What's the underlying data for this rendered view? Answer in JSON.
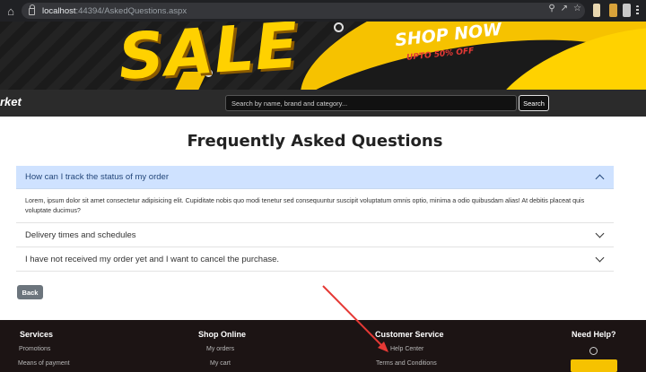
{
  "browser": {
    "url_host": "localhost",
    "url_rest": ":44394/AskedQuestions.aspx"
  },
  "banner": {
    "sale_text": "SALE",
    "shop_now_text": "SHOP NOW",
    "upto_text": "UPTO 50% OFF"
  },
  "navbar": {
    "brand": "rket",
    "search_placeholder": "Search by name, brand and category...",
    "search_button": "Search"
  },
  "page": {
    "title": "Frequently Asked Questions",
    "faqs": [
      {
        "question": "How can I track the status of my order",
        "answer": "Lorem, ipsum dolor sit amet consectetur adipisicing elit. Cupiditate nobis quo modi tenetur sed consequuntur suscipit voluptatum omnis optio, minima a odio quibusdam alias! At debitis placeat quis voluptate ducimus?"
      },
      {
        "question": "Delivery times and schedules"
      },
      {
        "question": "I have not received my order yet and I want to cancel the purchase."
      }
    ],
    "back_button": "Back"
  },
  "footer": {
    "services": {
      "heading": "Services",
      "links": [
        "Promotions",
        "Means of payment"
      ]
    },
    "shop_online": {
      "heading": "Shop Online",
      "links": [
        "My orders",
        "My cart"
      ]
    },
    "customer_service": {
      "heading": "Customer Service",
      "links": [
        "Help Center",
        "Terms and Conditions"
      ]
    },
    "need_help": {
      "heading": "Need Help?"
    }
  },
  "annotation": {
    "arrow_color": "#e53935"
  }
}
